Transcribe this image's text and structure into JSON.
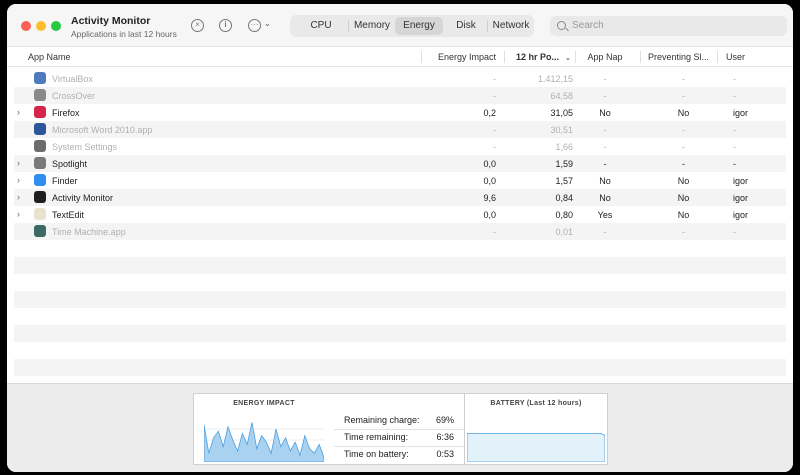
{
  "window": {
    "title": "Activity Monitor",
    "subtitle": "Applications in last 12 hours"
  },
  "toolbar": {
    "icons": [
      "stop-process-icon",
      "info-icon",
      "more-actions-icon",
      "chevron-down-icon"
    ],
    "tabs": [
      {
        "label": "CPU",
        "active": false
      },
      {
        "label": "Memory",
        "active": false
      },
      {
        "label": "Energy",
        "active": true
      },
      {
        "label": "Disk",
        "active": false
      },
      {
        "label": "Network",
        "active": false
      }
    ],
    "search_placeholder": "Search"
  },
  "table": {
    "columns": [
      "App Name",
      "Energy Impact",
      "12 hr Po...",
      "App Nap",
      "Preventing Sl...",
      "User"
    ],
    "sorted_column": "12 hr Po...",
    "rows": [
      {
        "name": "VirtualBox",
        "energy": "-",
        "power12": "1.412,15",
        "appnap": "-",
        "preventing": "-",
        "user": "-",
        "dim": true,
        "expandable": false,
        "icon": "virtualbox-icon",
        "color": "#4e7bbd"
      },
      {
        "name": "CrossOver",
        "energy": "-",
        "power12": "64,58",
        "appnap": "-",
        "preventing": "-",
        "user": "-",
        "dim": true,
        "expandable": false,
        "icon": "crossover-icon",
        "color": "#8a8a8a"
      },
      {
        "name": "Firefox",
        "energy": "0,2",
        "power12": "31,05",
        "appnap": "No",
        "preventing": "No",
        "user": "igor",
        "dim": false,
        "expandable": true,
        "icon": "firefox-icon",
        "color": "#d5254b"
      },
      {
        "name": "Microsoft Word 2010.app",
        "energy": "-",
        "power12": "30,51",
        "appnap": "-",
        "preventing": "-",
        "user": "-",
        "dim": true,
        "expandable": false,
        "icon": "word-icon",
        "color": "#2b579a"
      },
      {
        "name": "System Settings",
        "energy": "-",
        "power12": "1,66",
        "appnap": "-",
        "preventing": "-",
        "user": "-",
        "dim": true,
        "expandable": false,
        "icon": "system-settings-icon",
        "color": "#6d6d6d"
      },
      {
        "name": "Spotlight",
        "energy": "0,0",
        "power12": "1,59",
        "appnap": "-",
        "preventing": "-",
        "user": "-",
        "dim": false,
        "expandable": true,
        "icon": "spotlight-icon",
        "color": "#7a7a7a"
      },
      {
        "name": "Finder",
        "energy": "0,0",
        "power12": "1,57",
        "appnap": "No",
        "preventing": "No",
        "user": "igor",
        "dim": false,
        "expandable": true,
        "icon": "finder-icon",
        "color": "#2f8ef0"
      },
      {
        "name": "Activity Monitor",
        "energy": "9,6",
        "power12": "0,84",
        "appnap": "No",
        "preventing": "No",
        "user": "igor",
        "dim": false,
        "expandable": true,
        "icon": "activity-monitor-icon",
        "color": "#1e1e1e"
      },
      {
        "name": "TextEdit",
        "energy": "0,0",
        "power12": "0,80",
        "appnap": "Yes",
        "preventing": "No",
        "user": "igor",
        "dim": false,
        "expandable": true,
        "icon": "textedit-icon",
        "color": "#e9e2cf"
      },
      {
        "name": "Time Machine.app",
        "energy": "-",
        "power12": "0,01",
        "appnap": "-",
        "preventing": "-",
        "user": "-",
        "dim": true,
        "expandable": false,
        "icon": "time-machine-icon",
        "color": "#3a6a63"
      }
    ]
  },
  "bottom": {
    "energy_title": "ENERGY IMPACT",
    "energy_graph": [
      0.85,
      0.2,
      0.55,
      0.7,
      0.35,
      0.8,
      0.5,
      0.25,
      0.65,
      0.4,
      0.9,
      0.3,
      0.6,
      0.45,
      0.2,
      0.75,
      0.35,
      0.55,
      0.25,
      0.45,
      0.15,
      0.6,
      0.3,
      0.2,
      0.4,
      0.1
    ],
    "stats": [
      {
        "label": "Remaining charge:",
        "value": "69%"
      },
      {
        "label": "Time remaining:",
        "value": "6:36"
      },
      {
        "label": "Time on battery:",
        "value": "0:53"
      }
    ],
    "battery_title": "BATTERY (Last 12 hours)",
    "battery_level": 0.69
  },
  "colors": {
    "accent": "#4a9fe0",
    "graph_fill": "#a9d2f1",
    "dim_text": "#b0b0b0"
  }
}
